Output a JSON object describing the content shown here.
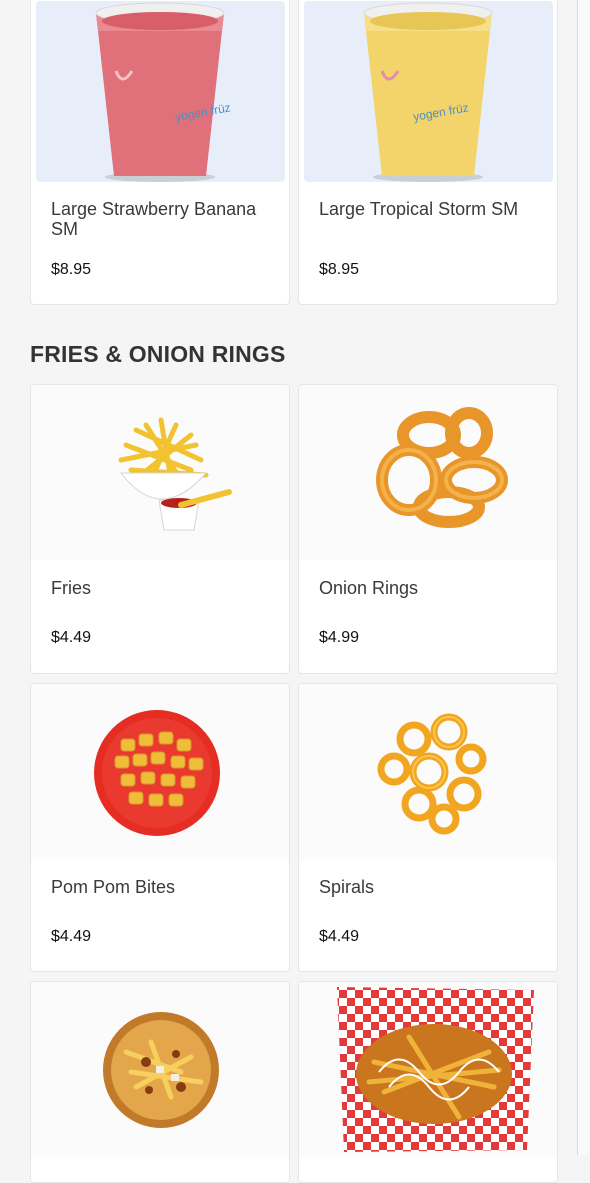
{
  "drinks": [
    {
      "name": "Large Strawberry Banana SM",
      "price": "$8.95",
      "cup_color": "#e0717a",
      "cup_logo": "yogen früz"
    },
    {
      "name": "Large Tropical Storm SM",
      "price": "$8.95",
      "cup_color": "#f2d46a",
      "cup_logo": "yogen früz"
    }
  ],
  "section": {
    "title": "FRIES & ONION RINGS"
  },
  "items": [
    {
      "name": "Fries",
      "price": "$4.49",
      "icon": "fries-icon"
    },
    {
      "name": "Onion Rings",
      "price": "$4.99",
      "icon": "onion-rings-icon"
    },
    {
      "name": "Pom Pom Bites",
      "price": "$4.49",
      "icon": "pom-pom-bites-icon"
    },
    {
      "name": "Spirals",
      "price": "$4.49",
      "icon": "spirals-icon"
    },
    {
      "name": "",
      "price": "",
      "icon": "poutine-icon"
    },
    {
      "name": "",
      "price": "",
      "icon": "loaded-fries-icon"
    }
  ],
  "colors": {
    "accent": "#e63a2b",
    "background": "#f5f5f6",
    "card": "#ffffff"
  }
}
